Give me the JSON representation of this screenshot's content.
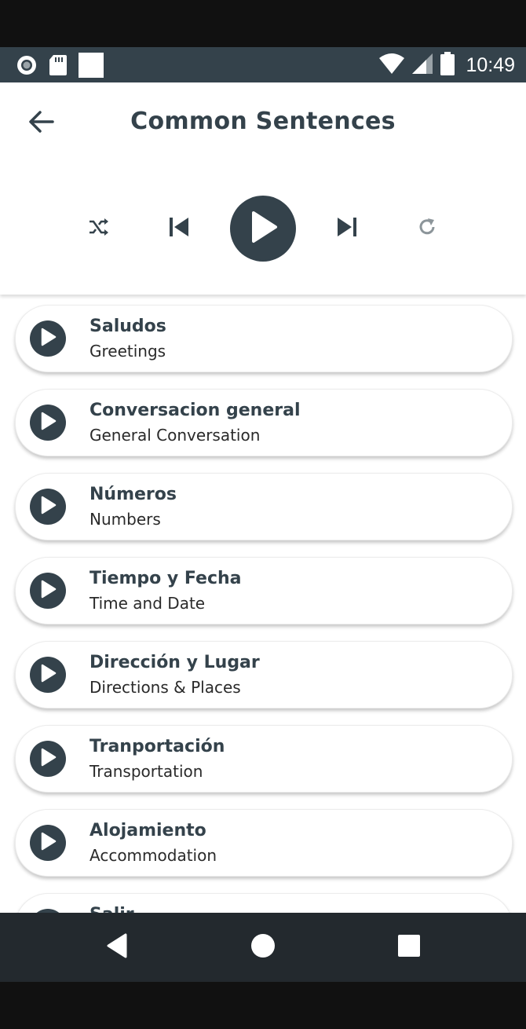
{
  "status_bar": {
    "time": "10:49",
    "icons_left": [
      "record-icon",
      "sd-card-icon",
      "square-notification-icon"
    ],
    "icons_right": [
      "wifi-icon",
      "signal-icon",
      "battery-icon"
    ]
  },
  "header": {
    "title": "Common Sentences",
    "back_icon": "arrow-left-icon"
  },
  "player": {
    "controls": [
      "shuffle-icon",
      "skip-previous-icon",
      "play-icon",
      "skip-next-icon",
      "repeat-icon"
    ]
  },
  "list": {
    "items": [
      {
        "title": "Saludos",
        "subtitle": "Greetings"
      },
      {
        "title": "Conversacion general",
        "subtitle": "General Conversation"
      },
      {
        "title": "Números",
        "subtitle": "Numbers"
      },
      {
        "title": "Tiempo y Fecha",
        "subtitle": "Time and Date"
      },
      {
        "title": "Dirección y Lugar",
        "subtitle": "Directions & Places"
      },
      {
        "title": "Tranportación",
        "subtitle": "Transportation"
      },
      {
        "title": "Alojamiento",
        "subtitle": "Accommodation"
      },
      {
        "title": "Salir",
        "subtitle": ""
      }
    ]
  },
  "nav_bar": {
    "buttons": [
      "nav-back-icon",
      "nav-home-icon",
      "nav-recent-icon"
    ]
  },
  "colors": {
    "primary": "#34424b",
    "status_bar": "#34424b",
    "nav_bar": "#23292e",
    "background": "#ffffff"
  }
}
